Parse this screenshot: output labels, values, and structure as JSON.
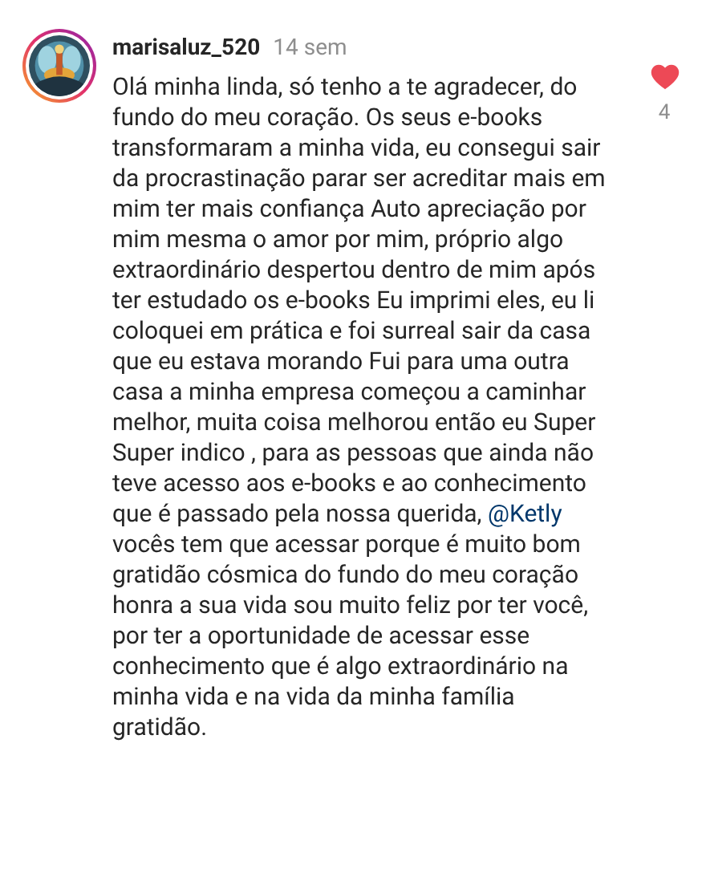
{
  "comment": {
    "username": "marisaluz_520",
    "time": "14 sem",
    "text_before": "Olá minha linda, só tenho a te agradecer, do fundo do meu coração. Os seus e-books transformaram a minha vida, eu consegui sair da procrastinação parar ser acreditar mais em mim ter mais confiança Auto apreciação por mim mesma o amor por mim, próprio algo extraordinário despertou dentro de mim após ter estudado os e-books Eu imprimi eles, eu li coloquei em prática e foi surreal sair da casa que eu estava morando Fui para uma outra casa a minha empresa começou a caminhar melhor, muita coisa melhorou então eu Super Super indico , para as pessoas que ainda não teve acesso aos e-books e ao conhecimento que é passado pela nossa querida,",
    "mention": "@Ketly",
    "text_after": "vocês tem que acessar porque é muito bom gratidão cósmica do fundo do meu coração honra a sua vida sou muito feliz por ter você, por ter a oportunidade de acessar esse conhecimento que é algo extraordinário na minha vida e na vida da minha família gratidão.",
    "liked": true,
    "like_count": "4"
  }
}
